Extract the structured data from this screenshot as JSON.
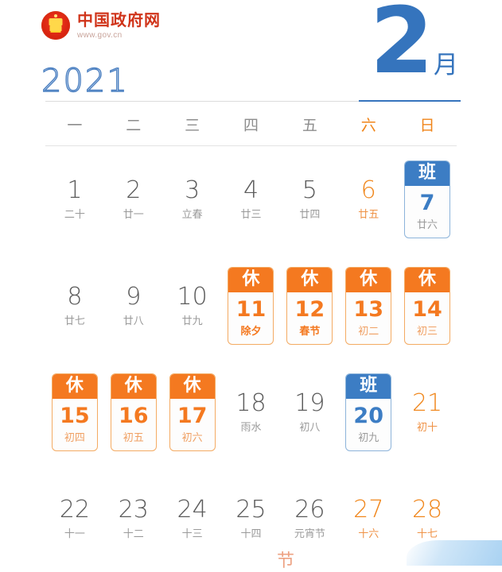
{
  "brand": {
    "emblem_icon": "national-emblem-icon",
    "title": "中国政府网",
    "url": "www.gov.cn"
  },
  "header": {
    "year": "2021",
    "month_number": "2",
    "month_label": "月"
  },
  "colors": {
    "blue": "#3574bd",
    "badge_blue": "#3c7dc4",
    "orange": "#f47920",
    "weekend_orange": "#f0871d",
    "red": "#d0341a",
    "gray_text": "#5b5b5b",
    "lunar_gray": "#9a9a9a"
  },
  "weekdays": [
    {
      "label": "一",
      "weekend": false
    },
    {
      "label": "二",
      "weekend": false
    },
    {
      "label": "三",
      "weekend": false
    },
    {
      "label": "四",
      "weekend": false
    },
    {
      "label": "五",
      "weekend": false
    },
    {
      "label": "六",
      "weekend": true
    },
    {
      "label": "日",
      "weekend": true
    }
  ],
  "days": [
    {
      "day": "1",
      "lunar": "二十",
      "type": "plain",
      "weekend": false
    },
    {
      "day": "2",
      "lunar": "廿一",
      "type": "plain",
      "weekend": false
    },
    {
      "day": "3",
      "lunar": "立春",
      "type": "plain",
      "weekend": false
    },
    {
      "day": "4",
      "lunar": "廿三",
      "type": "plain",
      "weekend": false
    },
    {
      "day": "5",
      "lunar": "廿四",
      "type": "plain",
      "weekend": false
    },
    {
      "day": "6",
      "lunar": "廿五",
      "type": "plain",
      "weekend": true
    },
    {
      "day": "7",
      "lunar": "廿六",
      "type": "work",
      "tag": "班",
      "weekend": true
    },
    {
      "day": "8",
      "lunar": "廿七",
      "type": "plain",
      "weekend": false
    },
    {
      "day": "9",
      "lunar": "廿八",
      "type": "plain",
      "weekend": false
    },
    {
      "day": "10",
      "lunar": "廿九",
      "type": "plain",
      "weekend": false
    },
    {
      "day": "11",
      "lunar": "除夕",
      "type": "rest",
      "tag": "休",
      "festival": true,
      "weekend": false
    },
    {
      "day": "12",
      "lunar": "春节",
      "type": "rest",
      "tag": "休",
      "festival": true,
      "weekend": false
    },
    {
      "day": "13",
      "lunar": "初二",
      "type": "rest",
      "tag": "休",
      "festival": false,
      "weekend": true
    },
    {
      "day": "14",
      "lunar": "初三",
      "type": "rest",
      "tag": "休",
      "festival": false,
      "weekend": true
    },
    {
      "day": "15",
      "lunar": "初四",
      "type": "rest",
      "tag": "休",
      "festival": false,
      "weekend": false
    },
    {
      "day": "16",
      "lunar": "初五",
      "type": "rest",
      "tag": "休",
      "festival": false,
      "weekend": false
    },
    {
      "day": "17",
      "lunar": "初六",
      "type": "rest",
      "tag": "休",
      "festival": false,
      "weekend": false
    },
    {
      "day": "18",
      "lunar": "雨水",
      "type": "plain",
      "weekend": false
    },
    {
      "day": "19",
      "lunar": "初八",
      "type": "plain",
      "weekend": false
    },
    {
      "day": "20",
      "lunar": "初九",
      "type": "work",
      "tag": "班",
      "weekend": true
    },
    {
      "day": "21",
      "lunar": "初十",
      "type": "plain",
      "weekend": true
    },
    {
      "day": "22",
      "lunar": "十一",
      "type": "plain",
      "weekend": false
    },
    {
      "day": "23",
      "lunar": "十二",
      "type": "plain",
      "weekend": false
    },
    {
      "day": "24",
      "lunar": "十三",
      "type": "plain",
      "weekend": false
    },
    {
      "day": "25",
      "lunar": "十四",
      "type": "plain",
      "weekend": false
    },
    {
      "day": "26",
      "lunar": "元宵节",
      "type": "plain",
      "weekend": false
    },
    {
      "day": "27",
      "lunar": "十六",
      "type": "plain",
      "weekend": true
    },
    {
      "day": "28",
      "lunar": "十七",
      "type": "plain",
      "weekend": true
    }
  ],
  "decoration": {
    "bottom_glyph": "节"
  }
}
